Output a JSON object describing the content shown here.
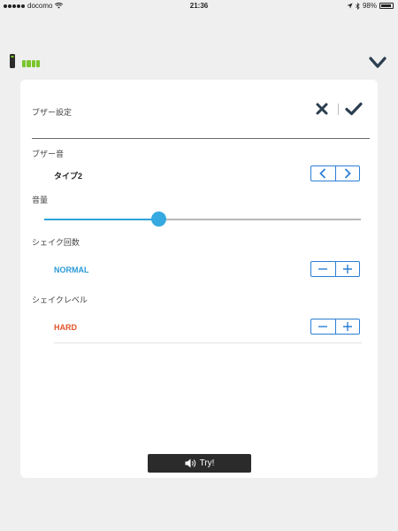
{
  "status_bar": {
    "carrier": "docomo",
    "time": "21:36",
    "battery_percent": "98%",
    "icons": [
      "signal-dots-icon",
      "wifi-icon",
      "location-icon",
      "bluetooth-icon",
      "battery-icon"
    ]
  },
  "device": {
    "icon": "remote-device-icon",
    "battery_icon": "battery-level-icon",
    "battery_color": "#7ac52d",
    "battery_level": 1.0,
    "collapse_icon": "chevron-down-icon"
  },
  "panel": {
    "title": "ブザー設定",
    "cancel_icon": "close-icon",
    "confirm_icon": "checkmark-icon"
  },
  "buzzer_sound": {
    "label": "ブザー音",
    "value": "タイプ2",
    "prev_icon": "chevron-left-icon",
    "next_icon": "chevron-right-icon"
  },
  "volume": {
    "label": "音量",
    "level": 0.36,
    "accent_color": "#35a9e0"
  },
  "shake_count": {
    "label": "シェイク回数",
    "value": "NORMAL",
    "value_color": "#2a9bd6",
    "minus_icon": "minus-icon",
    "plus_icon": "plus-icon"
  },
  "shake_level": {
    "label": "シェイクレベル",
    "value": "HARD",
    "value_color": "#e2522a",
    "minus_icon": "minus-icon",
    "plus_icon": "plus-icon"
  },
  "try_button": {
    "label": "Try!",
    "icon": "speaker-icon"
  },
  "colors": {
    "button_border": "#2a7fd4",
    "background": "#efefef",
    "card": "#ffffff"
  }
}
